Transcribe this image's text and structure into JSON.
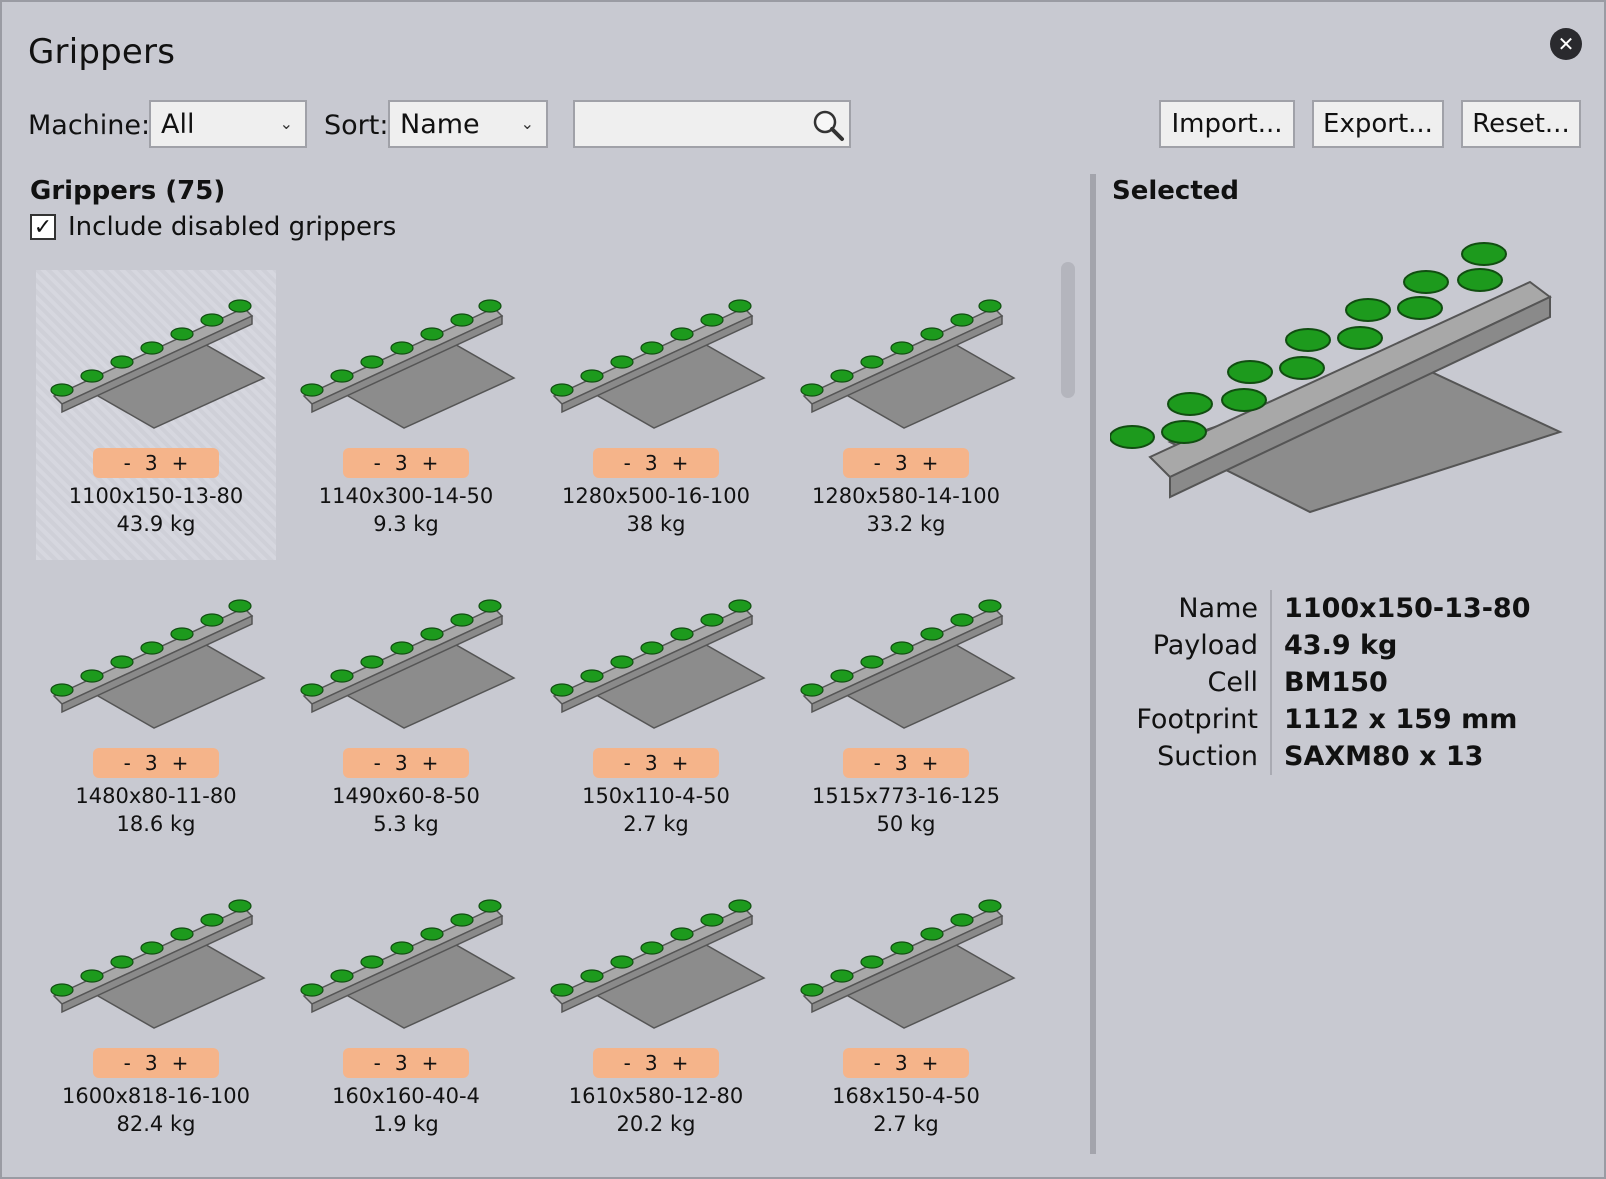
{
  "window": {
    "title": "Grippers"
  },
  "toolbar": {
    "machine_label": "Machine:",
    "machine_value": "All",
    "sort_label": "Sort:",
    "sort_value": "Name",
    "search_value": "",
    "import_label": "Import...",
    "export_label": "Export...",
    "reset_label": "Reset..."
  },
  "list": {
    "title": "Grippers (75)",
    "include_disabled_label": "Include disabled grippers",
    "include_disabled_checked": true,
    "items": [
      {
        "name": "1100x150-13-80",
        "mass": "43.9 kg",
        "qty": "3",
        "selected": true
      },
      {
        "name": "1140x300-14-50",
        "mass": "9.3 kg",
        "qty": "3"
      },
      {
        "name": "1280x500-16-100",
        "mass": "38 kg",
        "qty": "3"
      },
      {
        "name": "1280x580-14-100",
        "mass": "33.2 kg",
        "qty": "3"
      },
      {
        "name": "1480x80-11-80",
        "mass": "18.6 kg",
        "qty": "3"
      },
      {
        "name": "1490x60-8-50",
        "mass": "5.3 kg",
        "qty": "3"
      },
      {
        "name": "150x110-4-50",
        "mass": "2.7 kg",
        "qty": "3"
      },
      {
        "name": "1515x773-16-125",
        "mass": "50 kg",
        "qty": "3"
      },
      {
        "name": "1600x818-16-100",
        "mass": "82.4 kg",
        "qty": "3"
      },
      {
        "name": "160x160-40-4",
        "mass": "1.9 kg",
        "qty": "3"
      },
      {
        "name": "1610x580-12-80",
        "mass": "20.2 kg",
        "qty": "3"
      },
      {
        "name": "168x150-4-50",
        "mass": "2.7 kg",
        "qty": "3"
      }
    ],
    "qty_minus": "-",
    "qty_plus": "+"
  },
  "selected": {
    "title": "Selected",
    "fields": [
      {
        "key": "Name",
        "value": "1100x150-13-80"
      },
      {
        "key": "Payload",
        "value": "43.9 kg"
      },
      {
        "key": "Cell",
        "value": "BM150"
      },
      {
        "key": "Footprint",
        "value": "1112 x 159 mm"
      },
      {
        "key": "Suction",
        "value": "SAXM80 x 13"
      }
    ]
  },
  "colors": {
    "background": "#c8c9d1",
    "qty_badge": "#f5b48a",
    "cup_green": "#1d9a1d"
  }
}
